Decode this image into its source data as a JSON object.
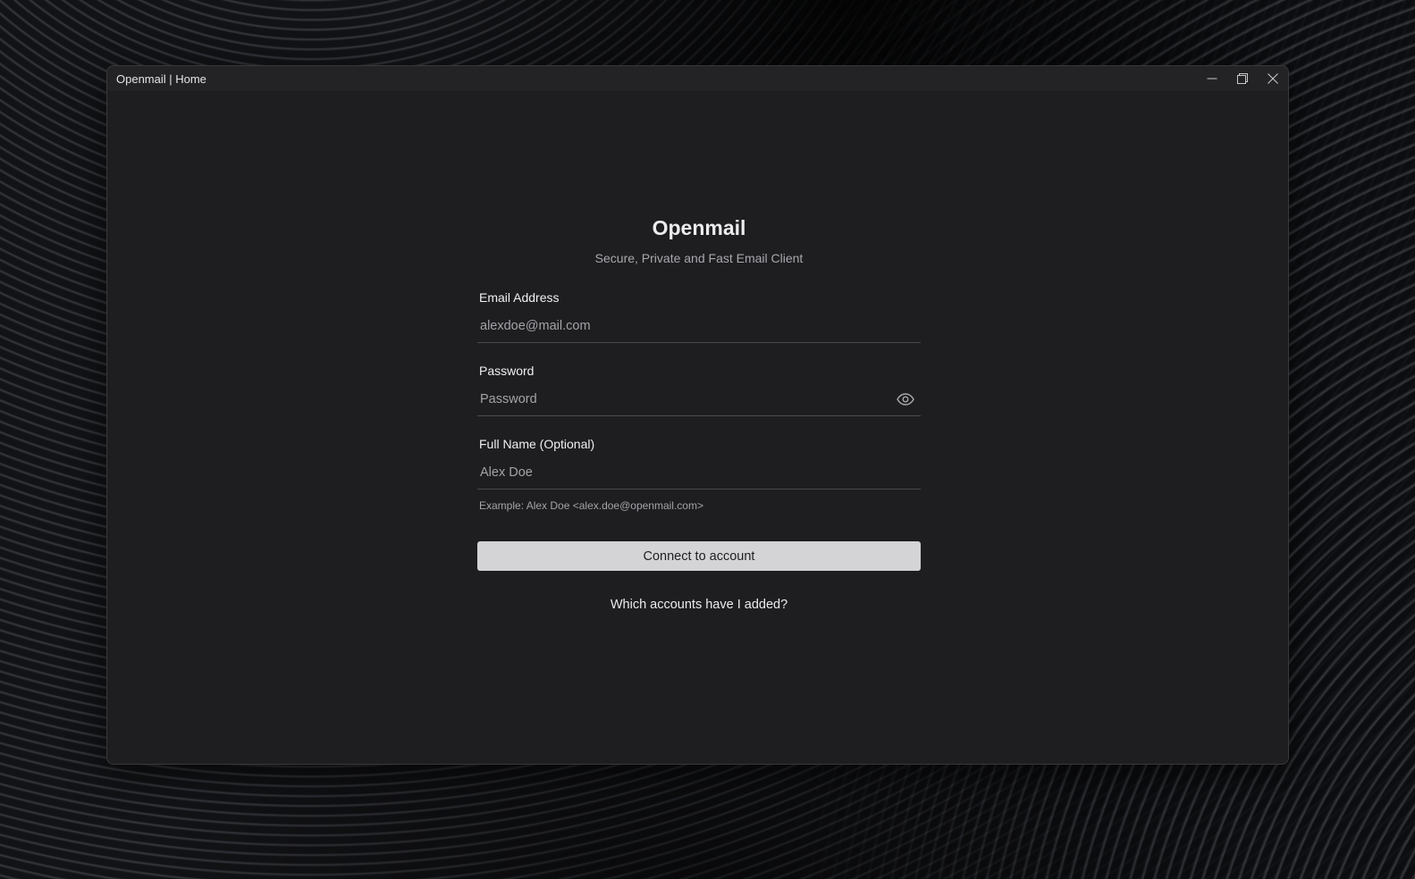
{
  "window": {
    "title": "Openmail | Home",
    "controls": [
      "minimize-icon",
      "restore-icon",
      "close-icon"
    ]
  },
  "app": {
    "title": "Openmail",
    "subtitle": "Secure, Private and Fast Email Client"
  },
  "form": {
    "email": {
      "label": "Email Address",
      "placeholder": "alexdoe@mail.com",
      "value": ""
    },
    "password": {
      "label": "Password",
      "placeholder": "Password",
      "value": "",
      "toggle_icon": "eye-icon"
    },
    "full_name": {
      "label": "Full Name (Optional)",
      "placeholder": "Alex Doe",
      "value": "",
      "hint": "Example: Alex Doe <alex.doe@openmail.com>"
    },
    "submit_label": "Connect to account",
    "accounts_link": "Which accounts have I added?"
  },
  "colors": {
    "window_bg": "#1e1e21",
    "titlebar_bg": "#232326",
    "button_bg": "#d4d4d6",
    "text_primary": "#ececee",
    "text_muted": "#a8a8ad"
  }
}
